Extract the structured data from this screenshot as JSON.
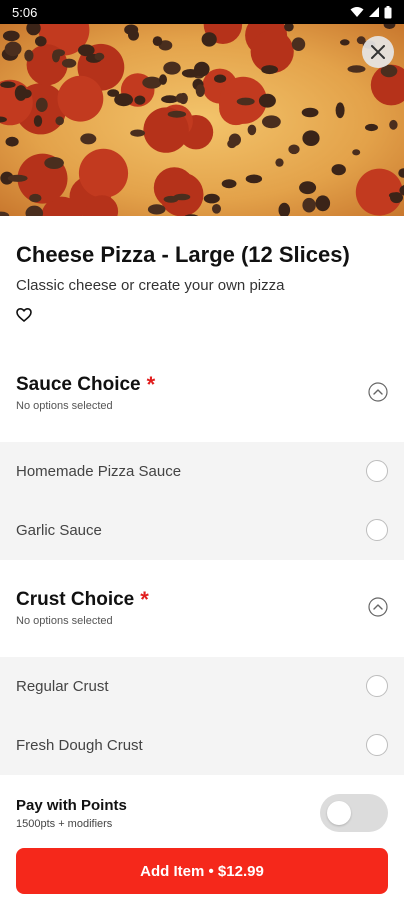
{
  "status_bar": {
    "time": "5:06"
  },
  "item": {
    "title": "Cheese Pizza - Large (12 Slices)",
    "description": "Classic cheese or create your own pizza"
  },
  "sections": [
    {
      "title": "Sauce Choice",
      "required_mark": "*",
      "status": "No options selected",
      "options": [
        "Homemade Pizza Sauce",
        "Garlic Sauce"
      ]
    },
    {
      "title": "Crust Choice",
      "required_mark": "*",
      "status": "No options selected",
      "options": [
        "Regular Crust",
        "Fresh Dough Crust"
      ]
    }
  ],
  "footer": {
    "pay_title": "Pay with Points",
    "pay_subtitle": "1500pts + modifiers",
    "pay_toggle_on": false,
    "add_button": "Add Item • $12.99"
  },
  "colors": {
    "accent": "#f5281b",
    "required": "#e11d1d",
    "option_background": "#f4f4f4"
  },
  "icons": {
    "close": "close-icon",
    "favorite": "heart-outline-icon",
    "collapse": "chevron-up-circle-icon",
    "wifi": "wifi-icon",
    "signal": "signal-icon",
    "battery": "battery-icon"
  }
}
